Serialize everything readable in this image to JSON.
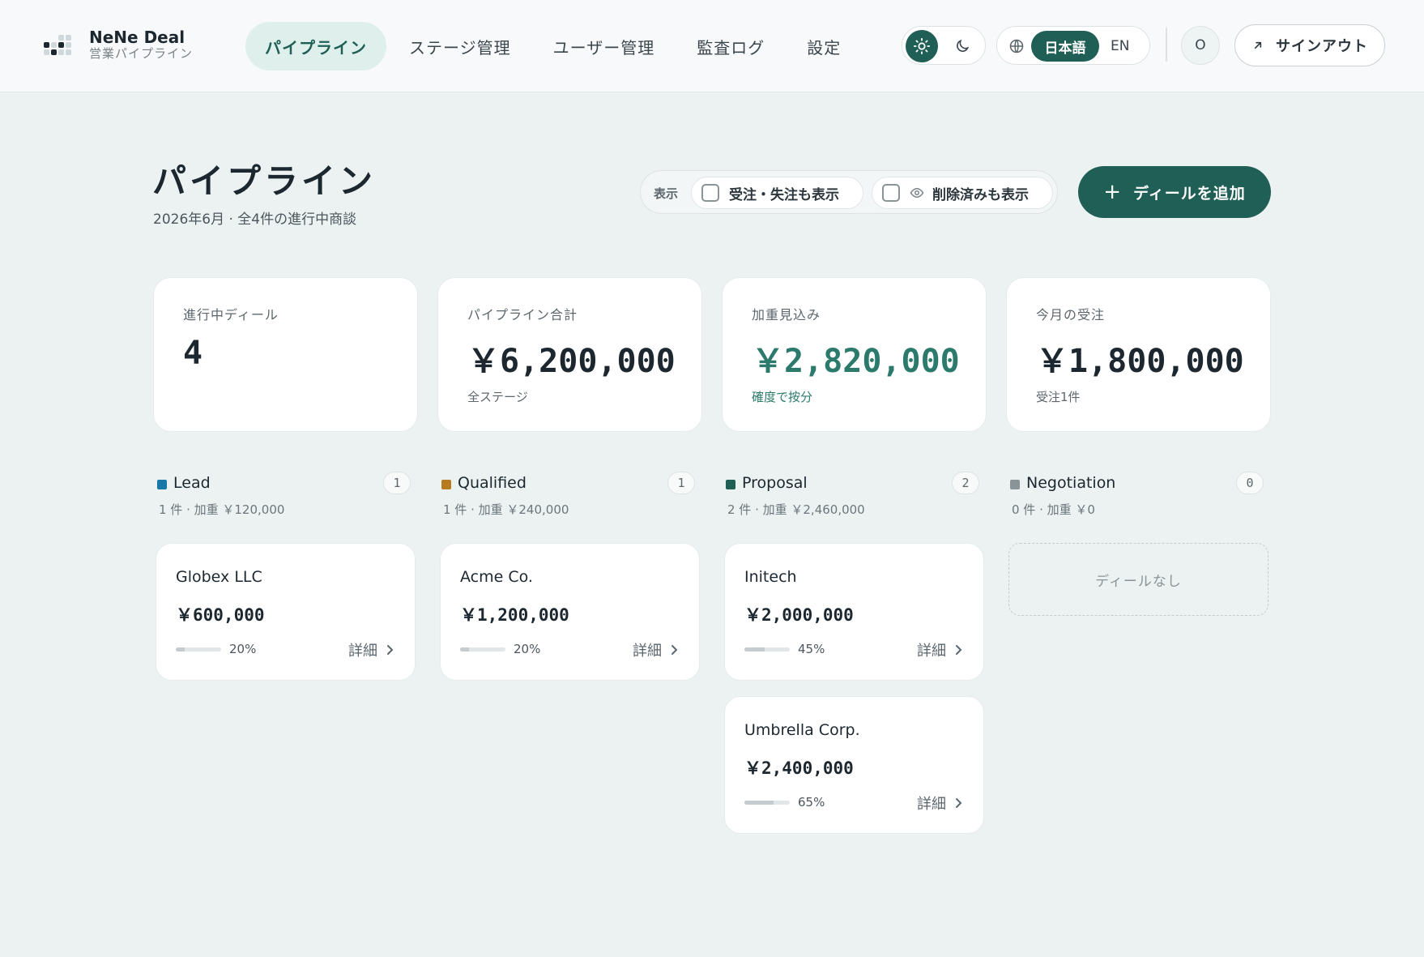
{
  "app": {
    "name": "NeNe Deal",
    "subtitle": "営業パイプライン"
  },
  "nav": [
    {
      "label": "パイプライン",
      "active": true
    },
    {
      "label": "ステージ管理",
      "active": false
    },
    {
      "label": "ユーザー管理",
      "active": false
    },
    {
      "label": "監査ログ",
      "active": false
    },
    {
      "label": "設定",
      "active": false
    }
  ],
  "theme": {
    "selected": "light"
  },
  "language": {
    "ja": "日本語",
    "en": "EN",
    "selected": "ja"
  },
  "user": {
    "initial": "O"
  },
  "signout_label": "サインアウト",
  "page": {
    "title": "パイプライン",
    "subtitle": "2026年6月 · 全4件の進行中商談"
  },
  "filters": {
    "label": "表示",
    "show_closed": "受注・失注も表示",
    "show_deleted": "削除済みも表示"
  },
  "add_deal_label": "ディールを追加",
  "stats": [
    {
      "label": "進行中ディール",
      "value": "4",
      "note": ""
    },
    {
      "label": "パイプライン合計",
      "value": "￥6,200,000",
      "note": "全ステージ"
    },
    {
      "label": "加重見込み",
      "value": "￥2,820,000",
      "note": "確度で按分"
    },
    {
      "label": "今月の受注",
      "value": "￥1,800,000",
      "note": "受注1件"
    }
  ],
  "stages": [
    {
      "name": "Lead",
      "color": "#1a78a8",
      "count": "1",
      "meta": "1 件 · 加重 ￥120,000",
      "deals": [
        {
          "name": "Globex LLC",
          "amount": "￥600,000",
          "probability": "20%",
          "probability_value": 0.2,
          "detail": "詳細"
        }
      ]
    },
    {
      "name": "Qualified",
      "color": "#b87a1e",
      "count": "1",
      "meta": "1 件 · 加重 ￥240,000",
      "deals": [
        {
          "name": "Acme Co.",
          "amount": "￥1,200,000",
          "probability": "20%",
          "probability_value": 0.2,
          "detail": "詳細"
        }
      ]
    },
    {
      "name": "Proposal",
      "color": "#1f5f55",
      "count": "2",
      "meta": "2 件 · 加重 ￥2,460,000",
      "deals": [
        {
          "name": "Initech",
          "amount": "￥2,000,000",
          "probability": "45%",
          "probability_value": 0.45,
          "detail": "詳細"
        },
        {
          "name": "Umbrella Corp.",
          "amount": "￥2,400,000",
          "probability": "65%",
          "probability_value": 0.65,
          "detail": "詳細"
        }
      ]
    },
    {
      "name": "Negotiation",
      "color": "#8a9398",
      "count": "0",
      "meta": "0 件 · 加重 ￥0",
      "empty_label": "ディールなし",
      "deals": []
    }
  ],
  "colors": {
    "accent": "#1f5f55",
    "accent_light": "#dff0ec",
    "background": "#ebf2f1",
    "positive": "#2b7a6b"
  }
}
